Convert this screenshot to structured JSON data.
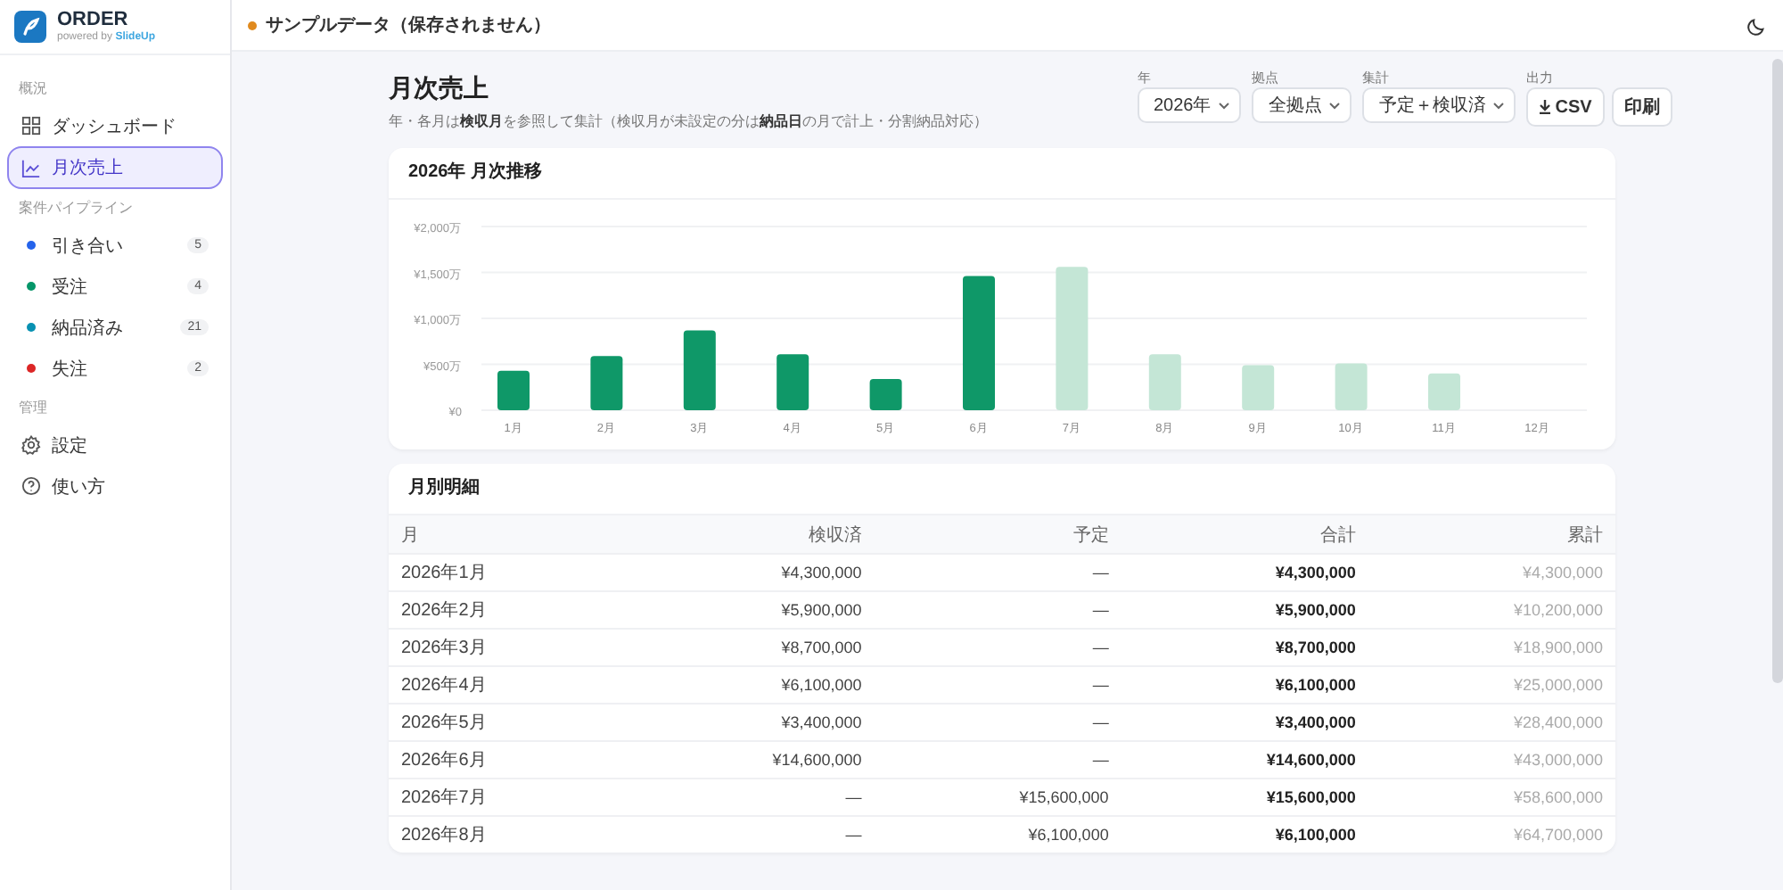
{
  "app": {
    "logo": "ORDER",
    "tagline_prefix": "powered by",
    "tagline_brand": "SlideUp"
  },
  "sidebar": {
    "sections": [
      {
        "label": "概況",
        "items": [
          {
            "label": "ダッシュボード",
            "kind": "dashboard",
            "selected": false
          },
          {
            "label": "月次売上",
            "kind": "chart",
            "selected": true
          }
        ]
      },
      {
        "label": "案件パイプライン",
        "items": [
          {
            "label": "引き合い",
            "kind": "status",
            "color": "#2563eb",
            "count": "5",
            "selected": false
          },
          {
            "label": "受注",
            "kind": "status",
            "color": "#059669",
            "count": "4",
            "selected": false
          },
          {
            "label": "納品済み",
            "kind": "status",
            "color": "#0891b2",
            "count": "21",
            "selected": false
          },
          {
            "label": "失注",
            "kind": "status",
            "color": "#dc2626",
            "count": "2",
            "selected": false
          }
        ]
      },
      {
        "label": "管理",
        "items": [
          {
            "label": "設定",
            "kind": "settings",
            "selected": false
          },
          {
            "label": "使い方",
            "kind": "help",
            "selected": false
          }
        ]
      }
    ]
  },
  "topbar": {
    "notice": "サンプルデータ（保存されません）"
  },
  "page": {
    "title": "月次売上",
    "subtitle": "年・各月は**検収月**を参照して集計（検収月が未設定の分は**納品日**の月で計上・分割納品対応）"
  },
  "filters": [
    {
      "label": "年",
      "value": "2026年"
    },
    {
      "label": "拠点",
      "value": "全拠点"
    },
    {
      "label": "集計",
      "value": "予定＋検収済"
    }
  ],
  "output": {
    "label": "出力",
    "buttons": [
      {
        "label": "CSV",
        "kind": "download"
      },
      {
        "label": "印刷",
        "kind": "plain"
      }
    ]
  },
  "chart_card": {
    "title": "2026年 月次推移",
    "chart_data": {
      "type": "bar",
      "stacked": true,
      "categories": [
        "1月",
        "2月",
        "3月",
        "4月",
        "5月",
        "6月",
        "7月",
        "8月",
        "9月",
        "10月",
        "11月",
        "12月"
      ],
      "series": [
        {
          "color": "#0f9868",
          "values": [
            430,
            590,
            870,
            610,
            340,
            1460,
            null,
            null,
            null,
            null,
            null,
            null
          ]
        },
        {
          "color": "#c4e6d6",
          "values": [
            null,
            null,
            null,
            null,
            null,
            null,
            1560,
            610,
            490,
            510,
            400,
            null
          ]
        }
      ],
      "ylim": [
        0,
        2000
      ],
      "grid": true,
      "yticks": [
        {
          "value": 0,
          "label": "¥0"
        },
        {
          "value": 500,
          "label": "¥500万"
        },
        {
          "value": 1000,
          "label": "¥1,000万"
        },
        {
          "value": 1500,
          "label": "¥1,500万"
        },
        {
          "value": 2000,
          "label": "¥2,000万"
        }
      ]
    }
  },
  "table": {
    "title": "月別明細",
    "columns": [
      {
        "label": "月",
        "kind": "text"
      },
      {
        "label": "検収済",
        "kind": "amount"
      },
      {
        "label": "予定",
        "kind": "amount"
      },
      {
        "label": "合計",
        "kind": "total"
      },
      {
        "label": "累計",
        "kind": "cumulative"
      }
    ],
    "rows": [
      [
        "2026年1月",
        "¥4,300,000",
        "—",
        "¥4,300,000",
        "¥4,300,000"
      ],
      [
        "2026年2月",
        "¥5,900,000",
        "—",
        "¥5,900,000",
        "¥10,200,000"
      ],
      [
        "2026年3月",
        "¥8,700,000",
        "—",
        "¥8,700,000",
        "¥18,900,000"
      ],
      [
        "2026年4月",
        "¥6,100,000",
        "—",
        "¥6,100,000",
        "¥25,000,000"
      ],
      [
        "2026年5月",
        "¥3,400,000",
        "—",
        "¥3,400,000",
        "¥28,400,000"
      ],
      [
        "2026年6月",
        "¥14,600,000",
        "—",
        "¥14,600,000",
        "¥43,000,000"
      ],
      [
        "2026年7月",
        "—",
        "¥15,600,000",
        "¥15,600,000",
        "¥58,600,000"
      ],
      [
        "2026年8月",
        "—",
        "¥6,100,000",
        "¥6,100,000",
        "¥64,700,000"
      ]
    ]
  }
}
